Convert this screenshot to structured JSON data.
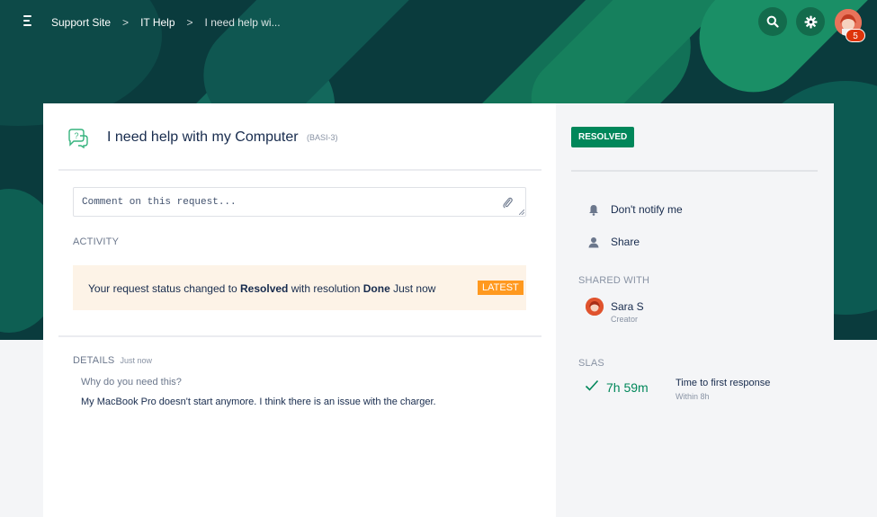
{
  "header": {
    "breadcrumbs": [
      "Support Site",
      "IT Help",
      "I need help wi..."
    ],
    "separator": ">",
    "notification_count": "5",
    "icons": [
      "menu-icon",
      "search-icon",
      "gear-icon",
      "avatar"
    ]
  },
  "request": {
    "title": "I need help with my Computer",
    "key": "(BASI-3)",
    "comment_placeholder": "Comment on this request..."
  },
  "activity": {
    "label": "ACTIVITY",
    "prefix": "Your request status changed to ",
    "status": "Resolved",
    "middle": " with resolution ",
    "resolution": "Done",
    "suffix": " Just now",
    "tag": "LATEST"
  },
  "details": {
    "label": "DETAILS",
    "time": "Just now",
    "question": "Why do you need this?",
    "answer": "My MacBook Pro doesn't start anymore. I think there is an issue with the charger."
  },
  "sidebar": {
    "status": "RESOLVED",
    "notify": "Don't notify me",
    "share": "Share",
    "shared_with_label": "SHARED WITH",
    "user_name": "Sara S",
    "user_role": "Creator",
    "slas_label": "SLAS",
    "sla_time": "7h 59m",
    "sla_name": "Time to first response",
    "sla_target": "Within 8h"
  },
  "colors": {
    "banner": "#0a3b3d",
    "accent_green": "#00875a",
    "latest_orange": "#ff991f",
    "activity_bg": "#fdf3e7"
  }
}
